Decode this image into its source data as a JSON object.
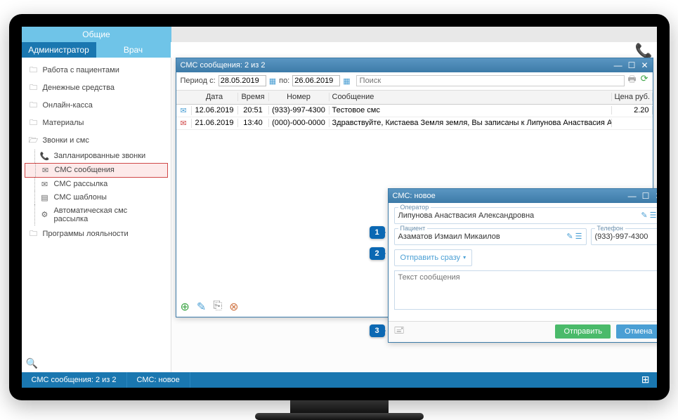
{
  "tabs": {
    "general": "Общие",
    "admin": "Администратор",
    "doctor": "Врач"
  },
  "sidebar": {
    "items": [
      {
        "label": "Работа с пациентами"
      },
      {
        "label": "Денежные средства"
      },
      {
        "label": "Онлайн-касса"
      },
      {
        "label": "Материалы"
      },
      {
        "label": "Звонки и смс"
      }
    ],
    "subitems": [
      {
        "label": "Запланированные звонки"
      },
      {
        "label": "СМС сообщения"
      },
      {
        "label": "СМС рассылка"
      },
      {
        "label": "СМС шаблоны"
      },
      {
        "label": "Автоматическая смс рассылка"
      }
    ],
    "loyalty": "Программы лояльности"
  },
  "list_window": {
    "title": "СМС сообщения: 2 из 2",
    "period_from_label": "Период с:",
    "period_to_label": "по:",
    "date_from": "28.05.2019",
    "date_to": "26.06.2019",
    "search_placeholder": "Поиск",
    "headers": {
      "date": "Дата",
      "time": "Время",
      "number": "Номер",
      "message": "Сообщение",
      "price": "Цена руб."
    },
    "rows": [
      {
        "date": "12.06.2019",
        "time": "20:51",
        "number": "(933)-997-4300",
        "message": "Тестовое смс",
        "price": "2.20",
        "unread": false
      },
      {
        "date": "21.06.2019",
        "time": "13:40",
        "number": "(000)-000-0000",
        "message": "Здравствуйте, Кистаева Земля земля, Вы записаны к Липунова Анаствасия Александ",
        "price": "",
        "unread": true
      }
    ]
  },
  "new_sms": {
    "title": "СМС: новое",
    "operator_label": "Оператор",
    "operator": "Липунова Анаствасия Александровна",
    "patient_label": "Пациент",
    "patient": "Азаматов Измаил Микаилов",
    "phone_label": "Телефон",
    "phone": "(933)-997-4300",
    "send_mode": "Отправить сразу",
    "msg_placeholder": "Текст сообщения",
    "send": "Отправить",
    "cancel": "Отмена"
  },
  "callouts": {
    "c1": "1",
    "c2": "2",
    "c3": "3"
  },
  "status": {
    "left1": "СМС сообщения: 2 из 2",
    "left2": "СМС: новое"
  }
}
